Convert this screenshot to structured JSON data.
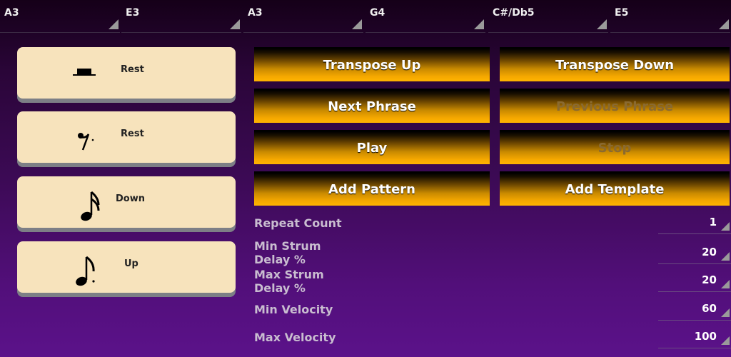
{
  "spinners": [
    {
      "value": "A3"
    },
    {
      "value": "E3"
    },
    {
      "value": "A3"
    },
    {
      "value": "G4"
    },
    {
      "value": "C#/Db5"
    },
    {
      "value": "E5"
    }
  ],
  "note_buttons": [
    {
      "label": "Rest",
      "icon": "half-rest-icon"
    },
    {
      "label": "Rest",
      "icon": "eighth-rest-icon"
    },
    {
      "label": "Down",
      "icon": "sixteenth-note-icon"
    },
    {
      "label": "Up",
      "icon": "eighth-note-icon"
    }
  ],
  "buttons": {
    "transpose_up": "Transpose Up",
    "transpose_down": "Transpose Down",
    "next_phrase": "Next Phrase",
    "previous_phrase": "Previous Phrase",
    "play": "Play",
    "stop": "Stop",
    "add_pattern": "Add Pattern",
    "add_template": "Add Template"
  },
  "settings": {
    "repeat_count": {
      "label": "Repeat Count",
      "value": "1"
    },
    "min_strum": {
      "label_line1": "Min Strum",
      "label_line2": "Delay %",
      "value": "20"
    },
    "max_strum": {
      "label_line1": "Max Strum",
      "label_line2": "Delay %",
      "value": "20"
    },
    "min_velocity": {
      "label": "Min Velocity",
      "value": "60"
    },
    "max_velocity": {
      "label": "Max Velocity",
      "value": "100"
    }
  },
  "colors": {
    "button_orange": "#ffb400",
    "note_button_bg": "#f7e3bc",
    "background_purple": "#5b128a"
  }
}
